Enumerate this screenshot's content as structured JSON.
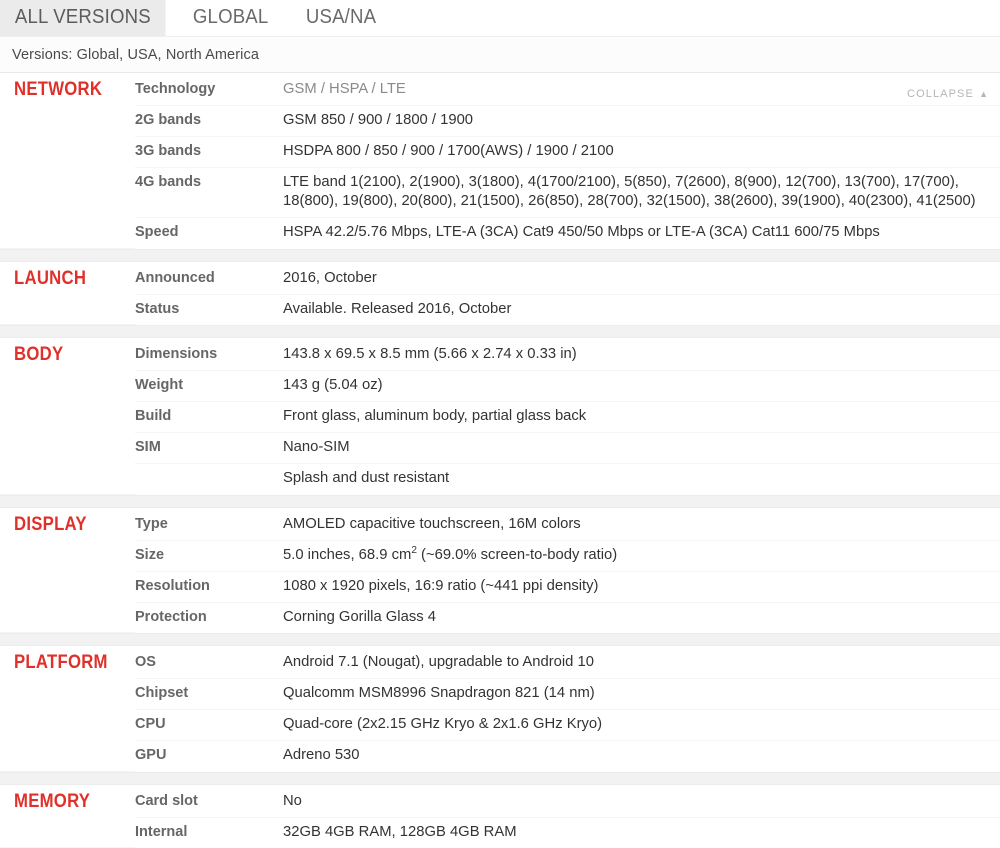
{
  "tabs": [
    {
      "label": "ALL VERSIONS",
      "active": true
    },
    {
      "label": "GLOBAL",
      "active": false
    },
    {
      "label": "USA/NA",
      "active": false
    }
  ],
  "versions_line": "Versions: Global, USA, North America",
  "collapse": {
    "label": "COLLAPSE",
    "caret": "▲"
  },
  "sections": [
    {
      "name": "NETWORK",
      "rows": [
        {
          "title": "Technology",
          "value": "GSM / HSPA / LTE",
          "muted": true
        },
        {
          "title": "2G bands",
          "value": "GSM 850 / 900 / 1800 / 1900",
          "muted": false
        },
        {
          "title": "3G bands",
          "value": "HSDPA 800 / 850 / 900 / 1700(AWS) / 1900 / 2100",
          "muted": false
        },
        {
          "title": "4G bands",
          "value": "LTE band 1(2100), 2(1900), 3(1800), 4(1700/2100), 5(850), 7(2600), 8(900), 12(700), 13(700), 17(700), 18(800), 19(800), 20(800), 21(1500), 26(850), 28(700), 32(1500), 38(2600), 39(1900), 40(2300), 41(2500)",
          "muted": false
        },
        {
          "title": "Speed",
          "value": "HSPA 42.2/5.76 Mbps, LTE-A (3CA) Cat9 450/50 Mbps or LTE-A (3CA) Cat11 600/75 Mbps",
          "muted": false
        }
      ]
    },
    {
      "name": "LAUNCH",
      "rows": [
        {
          "title": "Announced",
          "value": "2016, October",
          "muted": false
        },
        {
          "title": "Status",
          "value": "Available. Released 2016, October",
          "muted": false
        }
      ]
    },
    {
      "name": "BODY",
      "rows": [
        {
          "title": "Dimensions",
          "value": "143.8 x 69.5 x 8.5 mm (5.66 x 2.74 x 0.33 in)",
          "muted": false
        },
        {
          "title": "Weight",
          "value": "143 g (5.04 oz)",
          "muted": false
        },
        {
          "title": "Build",
          "value": "Front glass, aluminum body, partial glass back",
          "muted": false
        },
        {
          "title": "SIM",
          "value": "Nano-SIM",
          "muted": false
        },
        {
          "title": "",
          "value": "Splash and dust resistant",
          "muted": false
        }
      ]
    },
    {
      "name": "DISPLAY",
      "rows": [
        {
          "title": "Type",
          "value": "AMOLED capacitive touchscreen, 16M colors",
          "muted": false
        },
        {
          "title": "Size",
          "value_html": "5.0 inches, 68.9 cm<sup>2</sup> (~69.0% screen-to-body ratio)",
          "value": "5.0 inches, 68.9 cm2 (~69.0% screen-to-body ratio)",
          "muted": false
        },
        {
          "title": "Resolution",
          "value": "1080 x 1920 pixels, 16:9 ratio (~441 ppi density)",
          "muted": false
        },
        {
          "title": "Protection",
          "value": "Corning Gorilla Glass 4",
          "muted": false
        }
      ]
    },
    {
      "name": "PLATFORM",
      "rows": [
        {
          "title": "OS",
          "value": "Android 7.1 (Nougat), upgradable to Android 10",
          "muted": false
        },
        {
          "title": "Chipset",
          "value": "Qualcomm MSM8996 Snapdragon 821 (14 nm)",
          "muted": false
        },
        {
          "title": "CPU",
          "value": "Quad-core (2x2.15 GHz Kryo & 2x1.6 GHz Kryo)",
          "muted": false
        },
        {
          "title": "GPU",
          "value": "Adreno 530",
          "muted": false
        }
      ]
    },
    {
      "name": "MEMORY",
      "rows": [
        {
          "title": "Card slot",
          "value": "No",
          "muted": false
        },
        {
          "title": "Internal",
          "value": "32GB 4GB RAM, 128GB 4GB RAM",
          "muted": false
        }
      ]
    }
  ],
  "colors": {
    "section_label": "#e0302a",
    "row_title": "#666666",
    "row_value": "#333333",
    "row_value_muted": "#8a8a8a",
    "active_tab_bg": "#ebebeb",
    "divider_bg": "#f2f2f2"
  }
}
